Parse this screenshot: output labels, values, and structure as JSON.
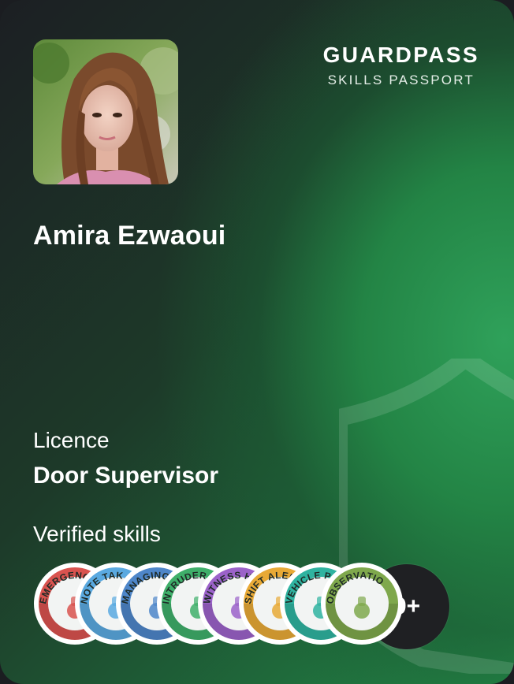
{
  "brand": {
    "title": "GUARDPASS",
    "subtitle": "SKILLS PASSPORT"
  },
  "profile": {
    "name": "Amira Ezwaoui"
  },
  "licence": {
    "label": "Licence",
    "value": "Door Supervisor"
  },
  "skills": {
    "label": "Verified skills",
    "badges": [
      {
        "text": "EMERGENCY P",
        "color": "#d9534f",
        "icon": "alarm-icon"
      },
      {
        "text": "NOTE TAK",
        "color": "#5aa9e0",
        "icon": "note-icon"
      },
      {
        "text": "MANAGING P",
        "color": "#4e86c9",
        "icon": "people-icon"
      },
      {
        "text": "INTRUDER RE",
        "color": "#3faf6a",
        "icon": "runner-icon"
      },
      {
        "text": "WITNESS HA",
        "color": "#9b62c9",
        "icon": "witness-icon"
      },
      {
        "text": "SHIFT ALER",
        "color": "#e8a936",
        "icon": "alert-icon"
      },
      {
        "text": "VEHICLE P",
        "color": "#2fb3a0",
        "icon": "vehicle-icon"
      },
      {
        "text": "OBSERVATIO",
        "color": "#7fa84c",
        "icon": "observation-icon"
      }
    ],
    "more_label": "9+"
  }
}
